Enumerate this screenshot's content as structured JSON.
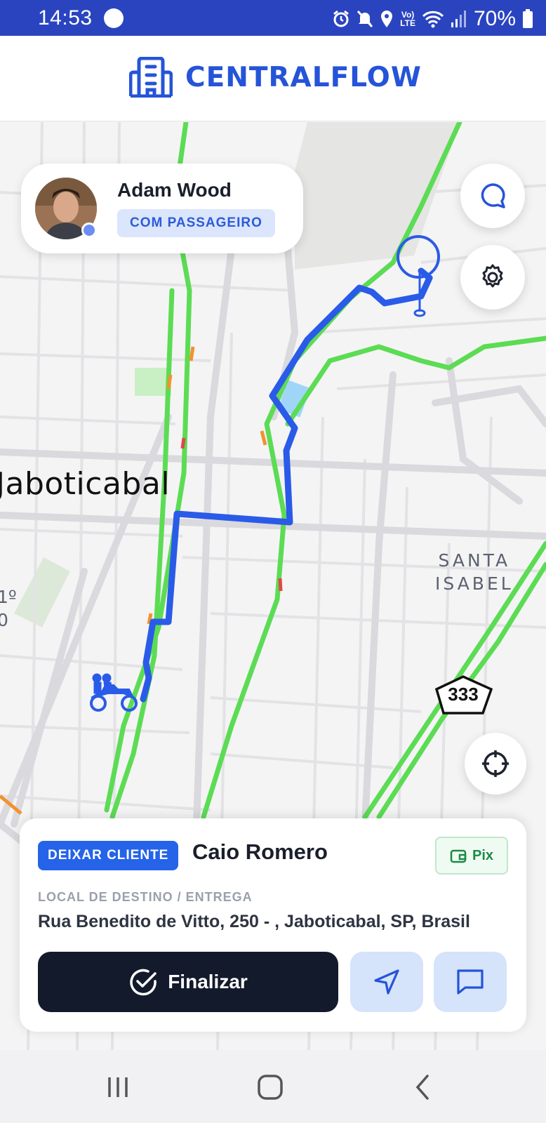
{
  "status_bar": {
    "time": "14:53",
    "network": "Vo) LTE",
    "battery": "70%",
    "icons": [
      "alarm-icon",
      "mute-icon",
      "location-icon",
      "wifi-icon",
      "signal-icon",
      "battery-icon"
    ]
  },
  "header": {
    "brand": "CENTRALFLOW",
    "logo_icon": "building-icon",
    "accent": "#2554d9"
  },
  "map": {
    "city_label": "Jaboticabal",
    "district_label_line1": "SANTA",
    "district_label_line2": "ISABEL",
    "edge_label_line1": "1º",
    "edge_label_line2": "0",
    "road_number": "333",
    "route_color": "#2a5be8",
    "traffic_color": "#5cdc54"
  },
  "driver": {
    "name": "Adam Wood",
    "status": "COM PASSAGEIRO"
  },
  "trip": {
    "badge": "DEIXAR CLIENTE",
    "client_name": "Caio Romero",
    "payment": "Pix",
    "destination_label": "LOCAL DE DESTINO / ENTREGA",
    "destination_address": "Rua Benedito de Vitto, 250 - , Jaboticabal, SP, Brasil",
    "finish_label": "Finalizar"
  }
}
